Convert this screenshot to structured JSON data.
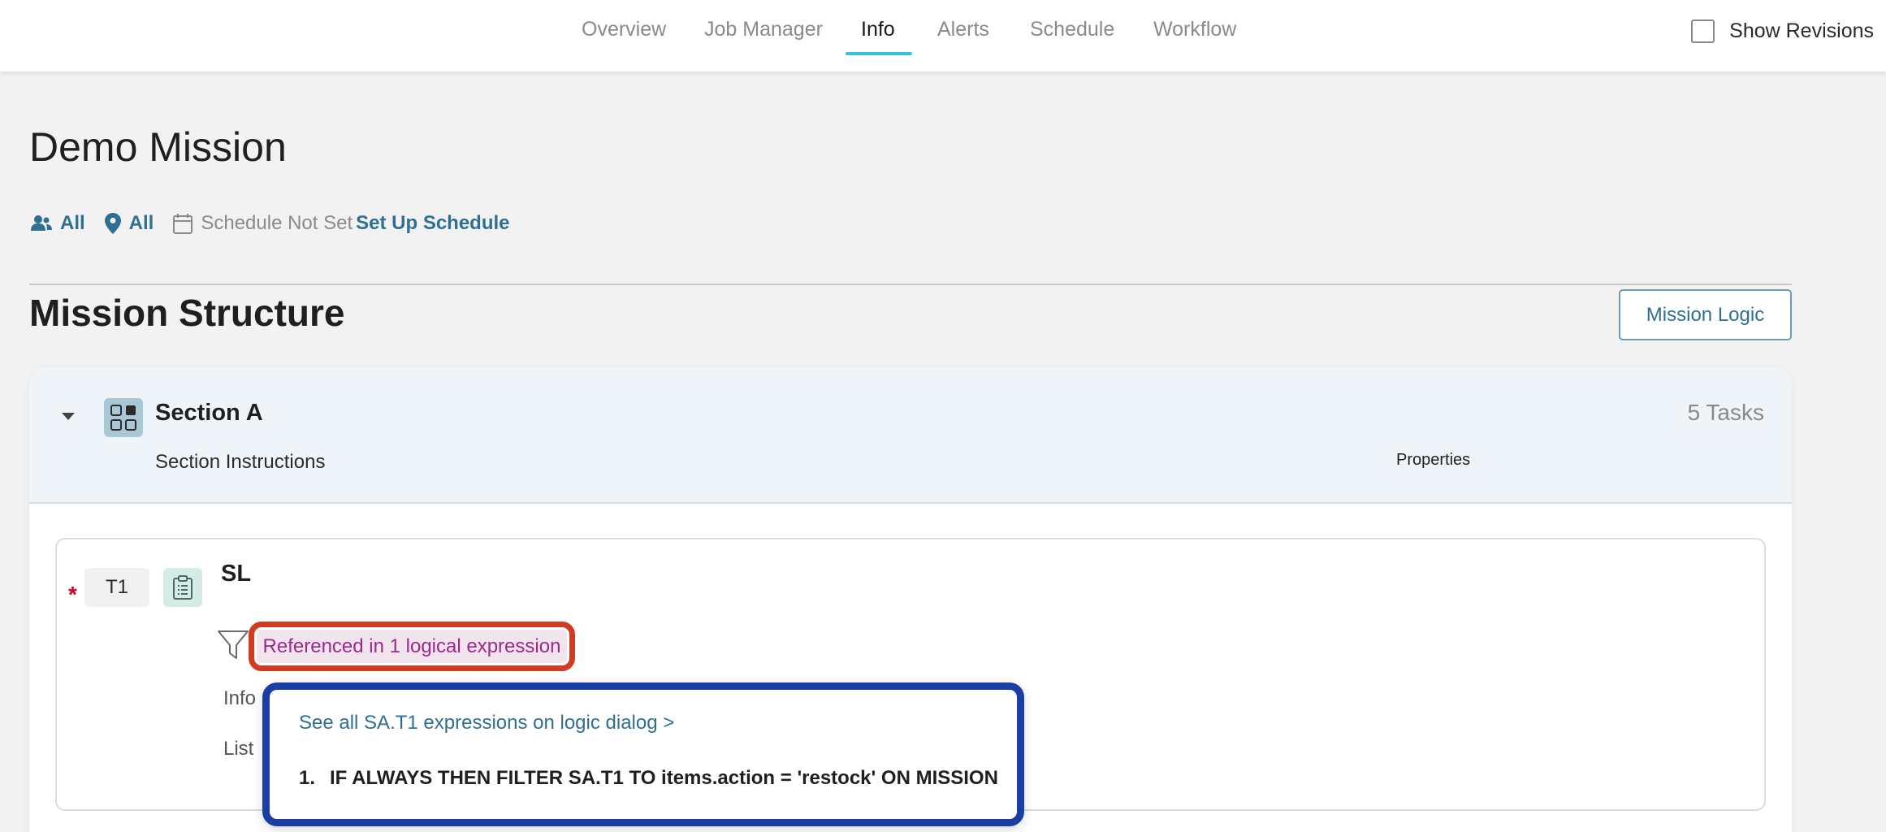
{
  "nav": {
    "tabs": [
      {
        "label": "Overview"
      },
      {
        "label": "Job Manager"
      },
      {
        "label": "Info"
      },
      {
        "label": "Alerts"
      },
      {
        "label": "Schedule"
      },
      {
        "label": "Workflow"
      }
    ],
    "active_tab": "Info",
    "show_revisions_label": "Show Revisions",
    "show_revisions_checked": false
  },
  "page": {
    "title": "Demo Mission",
    "meta": {
      "users_label": "All",
      "locations_label": "All",
      "schedule_status": "Schedule Not Set",
      "schedule_link": "Set Up Schedule"
    }
  },
  "structure": {
    "title": "Mission Structure",
    "mission_logic_button": "Mission Logic",
    "section": {
      "name": "Section A",
      "instructions_label": "Section Instructions",
      "properties_label": "Properties",
      "task_count": "5 Tasks",
      "task": {
        "required_mark": "*",
        "id": "T1",
        "name": "SL",
        "reference_label": "Referenced in 1 logical expression",
        "fields": [
          {
            "label": "Info"
          },
          {
            "label": "List"
          }
        ]
      }
    }
  },
  "popover": {
    "link_label": "See all SA.T1 expressions on logic dialog >",
    "expressions": [
      {
        "number": "1.",
        "text": "IF ALWAYS THEN FILTER SA.T1 TO items.action = 'restock' ON MISSION"
      }
    ]
  },
  "colors": {
    "accent_underline": "#34c3d8",
    "link_blue": "#2f6f93",
    "reference_text": "#9b2a8a",
    "highlight_red": "#d23a22",
    "highlight_blue": "#1b3ea6",
    "required_red": "#d0021b"
  },
  "icons": {
    "users": "users-icon",
    "location": "location-pin-icon",
    "calendar": "calendar-icon",
    "section": "grid-icon",
    "task": "clipboard-icon",
    "filter": "filter-icon",
    "caret": "caret-down-icon"
  }
}
